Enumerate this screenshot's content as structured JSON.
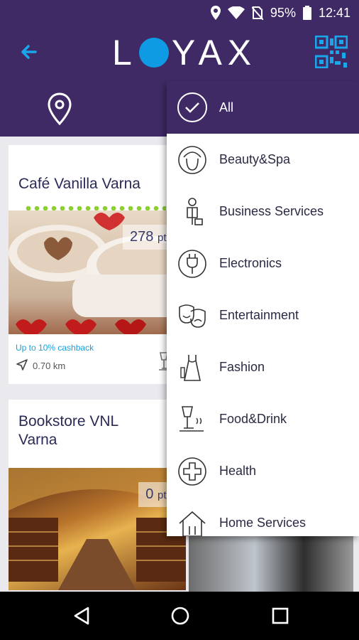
{
  "status": {
    "battery": "95%",
    "time": "12:41"
  },
  "app": {
    "logo": "LOYAX"
  },
  "cards": [
    {
      "title": "Café Vanilla Varna",
      "points": "278",
      "points_unit": "pts",
      "cashback": "Up to 10% cashback",
      "distance": "0.70 km"
    },
    {
      "title_line1": "Bookstore VNL",
      "title_line2": "Varna",
      "points": "0",
      "points_unit": "pts"
    }
  ],
  "dropdown": {
    "selected": "All",
    "items": [
      "Beauty&Spa",
      "Business Services",
      "Electronics",
      "Entertainment",
      "Fashion",
      "Food&Drink",
      "Health",
      "Home Services"
    ]
  },
  "colors": {
    "primary": "#3f2a66",
    "accent": "#0f9be3",
    "cashback": "#1a9fd9"
  }
}
